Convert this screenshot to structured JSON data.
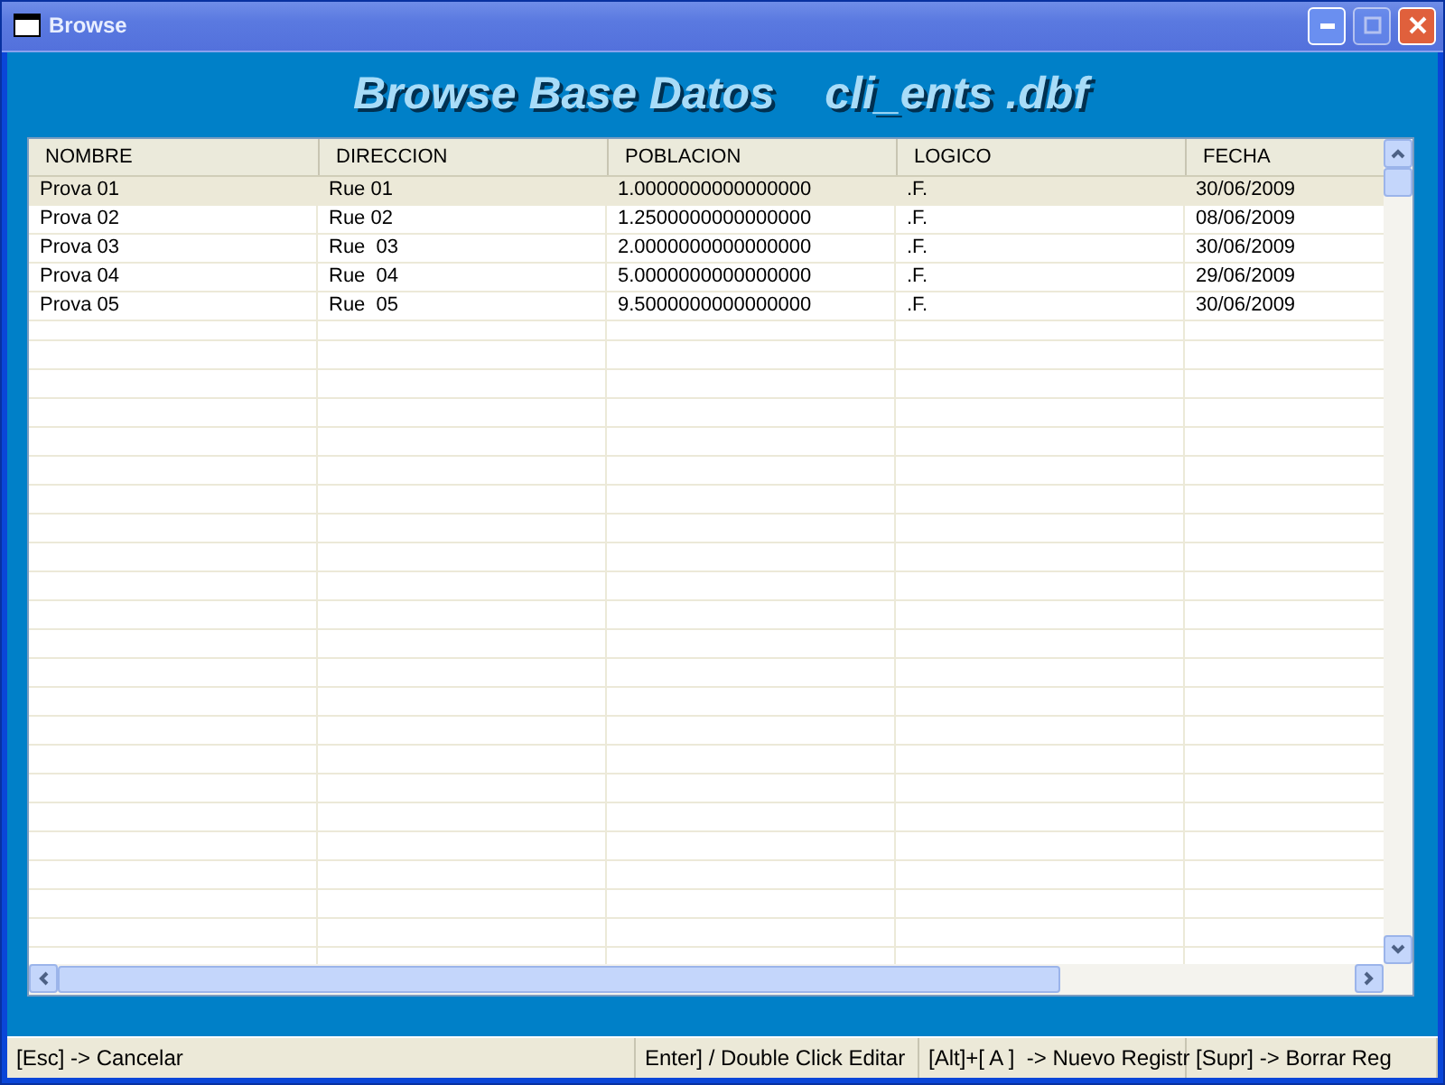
{
  "window": {
    "title": "Browse"
  },
  "heading": "Browse Base Datos    cli_ents .dbf",
  "table": {
    "columns": [
      "NOMBRE",
      "DIRECCION",
      "POBLACION",
      "LOGICO",
      "FECHA"
    ],
    "rows": [
      {
        "selected": true,
        "cells": [
          "Prova 01",
          "Rue 01",
          "1.0000000000000000",
          ".F.",
          "30/06/2009"
        ]
      },
      {
        "selected": false,
        "cells": [
          "Prova 02",
          "Rue 02",
          "1.2500000000000000",
          ".F.",
          "08/06/2009"
        ]
      },
      {
        "selected": false,
        "cells": [
          "Prova 03",
          "Rue  03",
          "2.0000000000000000",
          ".F.",
          "30/06/2009"
        ]
      },
      {
        "selected": false,
        "cells": [
          "Prova 04",
          "Rue  04",
          "5.0000000000000000",
          ".F.",
          "29/06/2009"
        ]
      },
      {
        "selected": false,
        "cells": [
          "Prova 05",
          "Rue  05",
          "9.5000000000000000",
          ".F.",
          "30/06/2009"
        ]
      }
    ]
  },
  "status_bar": [
    "[Esc] -> Cancelar",
    "Enter] / Double Click Editar",
    "[Alt]+[ A ]  -> Nuevo Registr",
    "[Supr] -> Borrar Reg"
  ]
}
